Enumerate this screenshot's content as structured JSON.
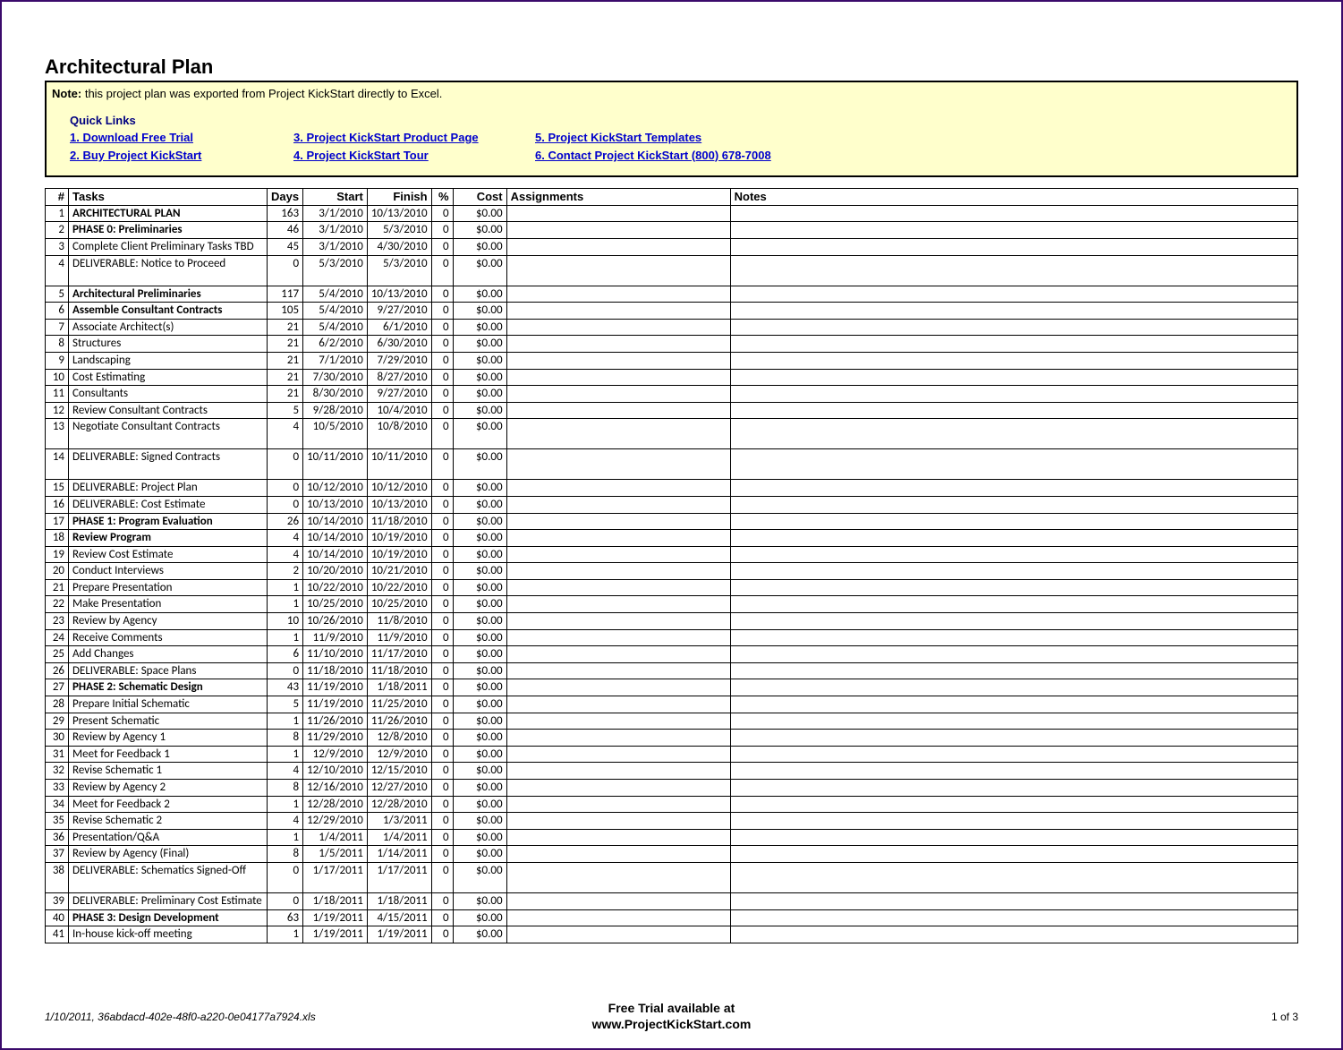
{
  "title": "Architectural Plan",
  "note": {
    "label": "Note:",
    "text": " this project plan was exported from Project KickStart directly to Excel."
  },
  "quick_links_label": "Quick Links",
  "links": {
    "l1": "1. Download Free Trial",
    "l2": "2. Buy Project KickStart",
    "l3": "3. Project KickStart Product Page",
    "l4": "4. Project KickStart Tour",
    "l5": "5. Project KickStart Templates",
    "l6": "6. Contact Project KickStart (800) 678-7008"
  },
  "columns": {
    "num": "#",
    "tasks": "Tasks",
    "days": "Days",
    "start": "Start",
    "finish": "Finish",
    "pct": "%",
    "cost": "Cost",
    "assignments": "Assignments",
    "notes": "Notes"
  },
  "rows": [
    {
      "num": "1",
      "task": "ARCHITECTURAL PLAN",
      "days": "163",
      "start": "3/1/2010",
      "finish": "10/13/2010",
      "pct": "0",
      "cost": "$0.00",
      "bold": true,
      "indent": 0
    },
    {
      "num": "2",
      "task": "PHASE 0: Preliminaries",
      "days": "46",
      "start": "3/1/2010",
      "finish": "5/3/2010",
      "pct": "0",
      "cost": "$0.00",
      "bold": true,
      "indent": 1
    },
    {
      "num": "3",
      "task": "Complete Client Preliminary Tasks TBD",
      "days": "45",
      "start": "3/1/2010",
      "finish": "4/30/2010",
      "pct": "0",
      "cost": "$0.00",
      "bold": false,
      "indent": 2
    },
    {
      "num": "4",
      "task": "DELIVERABLE: Notice to Proceed",
      "days": "0",
      "start": "5/3/2010",
      "finish": "5/3/2010",
      "pct": "0",
      "cost": "$0.00",
      "bold": false,
      "indent": 2,
      "tall": true
    },
    {
      "num": "5",
      "task": "Architectural Preliminaries",
      "days": "117",
      "start": "5/4/2010",
      "finish": "10/13/2010",
      "pct": "0",
      "cost": "$0.00",
      "bold": true,
      "indent": 1
    },
    {
      "num": "6",
      "task": "Assemble Consultant Contracts",
      "days": "105",
      "start": "5/4/2010",
      "finish": "9/27/2010",
      "pct": "0",
      "cost": "$0.00",
      "bold": true,
      "indent": 2
    },
    {
      "num": "7",
      "task": "Associate Architect(s)",
      "days": "21",
      "start": "5/4/2010",
      "finish": "6/1/2010",
      "pct": "0",
      "cost": "$0.00",
      "bold": false,
      "indent": 3
    },
    {
      "num": "8",
      "task": "Structures",
      "days": "21",
      "start": "6/2/2010",
      "finish": "6/30/2010",
      "pct": "0",
      "cost": "$0.00",
      "bold": false,
      "indent": 3
    },
    {
      "num": "9",
      "task": "Landscaping",
      "days": "21",
      "start": "7/1/2010",
      "finish": "7/29/2010",
      "pct": "0",
      "cost": "$0.00",
      "bold": false,
      "indent": 3
    },
    {
      "num": "10",
      "task": "Cost Estimating",
      "days": "21",
      "start": "7/30/2010",
      "finish": "8/27/2010",
      "pct": "0",
      "cost": "$0.00",
      "bold": false,
      "indent": 3
    },
    {
      "num": "11",
      "task": "Consultants",
      "days": "21",
      "start": "8/30/2010",
      "finish": "9/27/2010",
      "pct": "0",
      "cost": "$0.00",
      "bold": false,
      "indent": 3
    },
    {
      "num": "12",
      "task": "Review Consultant Contracts",
      "days": "5",
      "start": "9/28/2010",
      "finish": "10/4/2010",
      "pct": "0",
      "cost": "$0.00",
      "bold": false,
      "indent": 2
    },
    {
      "num": "13",
      "task": "Negotiate Consultant Contracts",
      "days": "4",
      "start": "10/5/2010",
      "finish": "10/8/2010",
      "pct": "0",
      "cost": "$0.00",
      "bold": false,
      "indent": 2,
      "tall": true
    },
    {
      "num": "14",
      "task": "DELIVERABLE: Signed Contracts",
      "days": "0",
      "start": "10/11/2010",
      "finish": "10/11/2010",
      "pct": "0",
      "cost": "$0.00",
      "bold": false,
      "indent": 2,
      "tall": true
    },
    {
      "num": "15",
      "task": "DELIVERABLE: Project Plan",
      "days": "0",
      "start": "10/12/2010",
      "finish": "10/12/2010",
      "pct": "0",
      "cost": "$0.00",
      "bold": false,
      "indent": 2
    },
    {
      "num": "16",
      "task": "DELIVERABLE: Cost Estimate",
      "days": "0",
      "start": "10/13/2010",
      "finish": "10/13/2010",
      "pct": "0",
      "cost": "$0.00",
      "bold": false,
      "indent": 2
    },
    {
      "num": "17",
      "task": "PHASE 1: Program Evaluation",
      "days": "26",
      "start": "10/14/2010",
      "finish": "11/18/2010",
      "pct": "0",
      "cost": "$0.00",
      "bold": true,
      "indent": 0
    },
    {
      "num": "18",
      "task": "Review Program",
      "days": "4",
      "start": "10/14/2010",
      "finish": "10/19/2010",
      "pct": "0",
      "cost": "$0.00",
      "bold": true,
      "indent": 1
    },
    {
      "num": "19",
      "task": "Review Cost Estimate",
      "days": "4",
      "start": "10/14/2010",
      "finish": "10/19/2010",
      "pct": "0",
      "cost": "$0.00",
      "bold": false,
      "indent": 2
    },
    {
      "num": "20",
      "task": "Conduct Interviews",
      "days": "2",
      "start": "10/20/2010",
      "finish": "10/21/2010",
      "pct": "0",
      "cost": "$0.00",
      "bold": false,
      "indent": 1
    },
    {
      "num": "21",
      "task": "Prepare Presentation",
      "days": "1",
      "start": "10/22/2010",
      "finish": "10/22/2010",
      "pct": "0",
      "cost": "$0.00",
      "bold": false,
      "indent": 1
    },
    {
      "num": "22",
      "task": "Make Presentation",
      "days": "1",
      "start": "10/25/2010",
      "finish": "10/25/2010",
      "pct": "0",
      "cost": "$0.00",
      "bold": false,
      "indent": 1
    },
    {
      "num": "23",
      "task": "Review by Agency",
      "days": "10",
      "start": "10/26/2010",
      "finish": "11/8/2010",
      "pct": "0",
      "cost": "$0.00",
      "bold": false,
      "indent": 1
    },
    {
      "num": "24",
      "task": "Receive Comments",
      "days": "1",
      "start": "11/9/2010",
      "finish": "11/9/2010",
      "pct": "0",
      "cost": "$0.00",
      "bold": false,
      "indent": 1
    },
    {
      "num": "25",
      "task": "Add Changes",
      "days": "6",
      "start": "11/10/2010",
      "finish": "11/17/2010",
      "pct": "0",
      "cost": "$0.00",
      "bold": false,
      "indent": 1
    },
    {
      "num": "26",
      "task": "DELIVERABLE: Space Plans",
      "days": "0",
      "start": "11/18/2010",
      "finish": "11/18/2010",
      "pct": "0",
      "cost": "$0.00",
      "bold": false,
      "indent": 1
    },
    {
      "num": "27",
      "task": "PHASE 2: Schematic Design",
      "days": "43",
      "start": "11/19/2010",
      "finish": "1/18/2011",
      "pct": "0",
      "cost": "$0.00",
      "bold": true,
      "indent": 0
    },
    {
      "num": "28",
      "task": "Prepare Initial Schematic",
      "days": "5",
      "start": "11/19/2010",
      "finish": "11/25/2010",
      "pct": "0",
      "cost": "$0.00",
      "bold": false,
      "indent": 1
    },
    {
      "num": "29",
      "task": "Present Schematic",
      "days": "1",
      "start": "11/26/2010",
      "finish": "11/26/2010",
      "pct": "0",
      "cost": "$0.00",
      "bold": false,
      "indent": 1
    },
    {
      "num": "30",
      "task": "Review by Agency 1",
      "days": "8",
      "start": "11/29/2010",
      "finish": "12/8/2010",
      "pct": "0",
      "cost": "$0.00",
      "bold": false,
      "indent": 1
    },
    {
      "num": "31",
      "task": "Meet for Feedback 1",
      "days": "1",
      "start": "12/9/2010",
      "finish": "12/9/2010",
      "pct": "0",
      "cost": "$0.00",
      "bold": false,
      "indent": 1
    },
    {
      "num": "32",
      "task": "Revise Schematic 1",
      "days": "4",
      "start": "12/10/2010",
      "finish": "12/15/2010",
      "pct": "0",
      "cost": "$0.00",
      "bold": false,
      "indent": 1
    },
    {
      "num": "33",
      "task": "Review by Agency 2",
      "days": "8",
      "start": "12/16/2010",
      "finish": "12/27/2010",
      "pct": "0",
      "cost": "$0.00",
      "bold": false,
      "indent": 1
    },
    {
      "num": "34",
      "task": "Meet for Feedback 2",
      "days": "1",
      "start": "12/28/2010",
      "finish": "12/28/2010",
      "pct": "0",
      "cost": "$0.00",
      "bold": false,
      "indent": 1
    },
    {
      "num": "35",
      "task": "Revise Schematic 2",
      "days": "4",
      "start": "12/29/2010",
      "finish": "1/3/2011",
      "pct": "0",
      "cost": "$0.00",
      "bold": false,
      "indent": 1
    },
    {
      "num": "36",
      "task": "Presentation/Q&A",
      "days": "1",
      "start": "1/4/2011",
      "finish": "1/4/2011",
      "pct": "0",
      "cost": "$0.00",
      "bold": false,
      "indent": 1
    },
    {
      "num": "37",
      "task": "Review by Agency (Final)",
      "days": "8",
      "start": "1/5/2011",
      "finish": "1/14/2011",
      "pct": "0",
      "cost": "$0.00",
      "bold": false,
      "indent": 1
    },
    {
      "num": "38",
      "task": "DELIVERABLE: Schematics Signed-Off",
      "days": "0",
      "start": "1/17/2011",
      "finish": "1/17/2011",
      "pct": "0",
      "cost": "$0.00",
      "bold": false,
      "indent": 1,
      "tall": true
    },
    {
      "num": "39",
      "task": "DELIVERABLE: Preliminary Cost Estimate",
      "days": "0",
      "start": "1/18/2011",
      "finish": "1/18/2011",
      "pct": "0",
      "cost": "$0.00",
      "bold": false,
      "indent": 1
    },
    {
      "num": "40",
      "task": "PHASE 3: Design Development",
      "days": "63",
      "start": "1/19/2011",
      "finish": "4/15/2011",
      "pct": "0",
      "cost": "$0.00",
      "bold": true,
      "indent": 0
    },
    {
      "num": "41",
      "task": "In-house kick-off meeting",
      "days": "1",
      "start": "1/19/2011",
      "finish": "1/19/2011",
      "pct": "0",
      "cost": "$0.00",
      "bold": false,
      "indent": 1
    }
  ],
  "footer": {
    "left": "1/10/2011, 36abdacd-402e-48f0-a220-0e04177a7924.xls",
    "center_l1": "Free Trial available at",
    "center_l2": "www.ProjectKickStart.com",
    "right": "1 of 3"
  }
}
